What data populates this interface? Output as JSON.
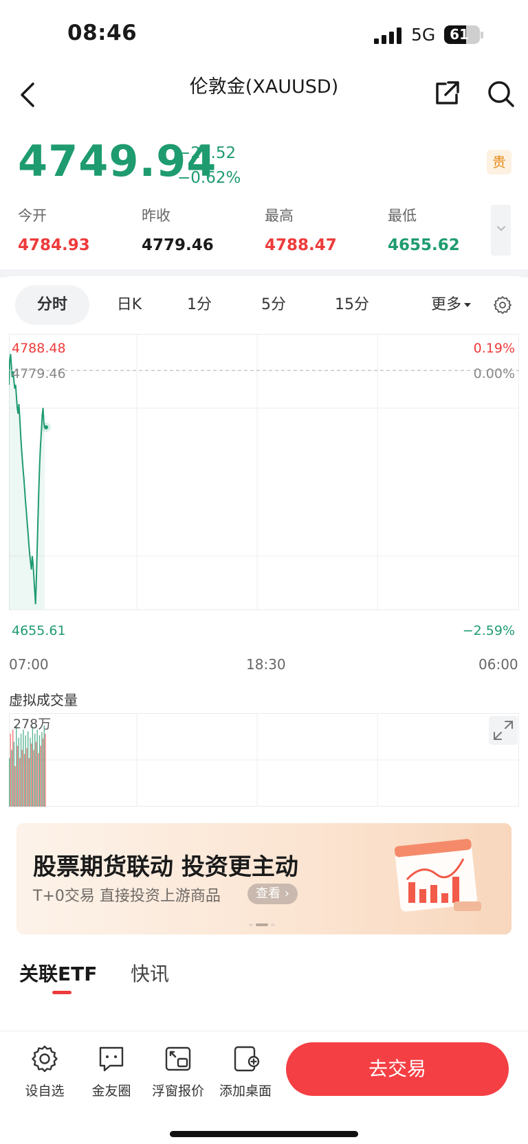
{
  "status_bar": {
    "time": "08:46",
    "network": "5G",
    "battery": "61",
    "battery_level": 0.61
  },
  "nav": {
    "title": "伦敦金(XAUUSD)"
  },
  "quote": {
    "price": "4749.94",
    "change": "−29.52",
    "change_pct": "−0.62%",
    "tag": "贵"
  },
  "stats": [
    {
      "label": "今开",
      "value": "4784.93",
      "color": "red"
    },
    {
      "label": "昨收",
      "value": "4779.46",
      "color": "dark"
    },
    {
      "label": "最高",
      "value": "4788.47",
      "color": "red"
    },
    {
      "label": "最低",
      "value": "4655.62",
      "color": "green"
    }
  ],
  "tabs": {
    "t0": "分时",
    "t1": "日K",
    "t2": "1分",
    "t3": "5分",
    "t4": "15分",
    "t5": "更多"
  },
  "chart_data": {
    "type": "line",
    "y_labels": {
      "high": "4788.48",
      "prev_close": "4779.46",
      "low": "4655.61"
    },
    "pct_labels": {
      "high": "0.19%",
      "zero": "0.00%",
      "low": "−2.59%"
    },
    "x_ticks": [
      "07:00",
      "18:30",
      "06:00"
    ],
    "ylim": [
      4655.61,
      4788.48
    ],
    "reference_line": 4779.46,
    "series": [
      {
        "values": [
          4772,
          4785,
          4788,
          4782,
          4776,
          4779,
          4774,
          4770,
          4772,
          4766,
          4760,
          4757,
          4762,
          4755,
          4747,
          4740,
          4734,
          4728,
          4723,
          4717,
          4711,
          4706,
          4700,
          4695,
          4689,
          4684,
          4680,
          4676,
          4683,
          4679,
          4672,
          4665,
          4658,
          4671,
          4687,
          4703,
          4718,
          4731,
          4741,
          4748,
          4756,
          4760,
          4752,
          4749.94
        ]
      }
    ],
    "grid": true
  },
  "volume": {
    "title": "虚拟成交量",
    "max_label": "278万",
    "bars": [
      0.6,
      0.9,
      0.7,
      0.95,
      0.8,
      0.5,
      1.0,
      0.75,
      0.85,
      0.6,
      0.9,
      0.7,
      0.95,
      0.65,
      0.88,
      0.72,
      0.93,
      0.6,
      0.85,
      0.78,
      0.99,
      0.7,
      0.9,
      0.8,
      0.95,
      0.66,
      0.88,
      0.75,
      0.92,
      0.84,
      1.0,
      0.9
    ]
  },
  "banner": {
    "headline": "股票期货联动 投资更主动",
    "sub": "T+0交易 直接投资上游商品",
    "cta": "查看",
    "arrow": "›"
  },
  "section_tabs": {
    "active": "关联ETF",
    "other": "快讯"
  },
  "bottom_bar": {
    "items": [
      {
        "label": "设自选",
        "icon": "gear-icon"
      },
      {
        "label": "金友圈",
        "icon": "chat-icon"
      },
      {
        "label": "浮窗报价",
        "icon": "float-window-icon"
      },
      {
        "label": "添加桌面",
        "icon": "add-desktop-icon"
      }
    ],
    "trade_label": "去交易"
  },
  "colors": {
    "up": "#ee3b3b",
    "down": "#1e9b6f",
    "accent": "#f43f44"
  }
}
